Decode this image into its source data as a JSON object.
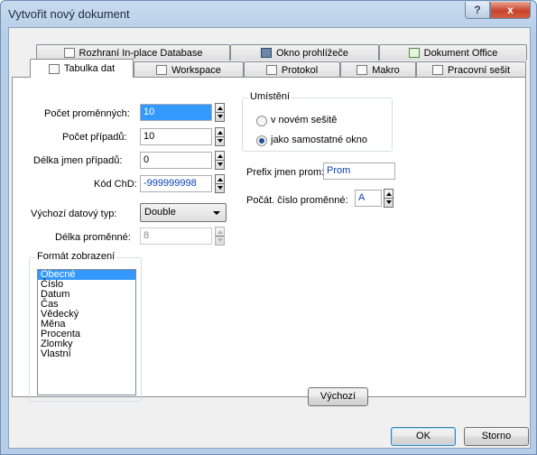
{
  "window": {
    "title": "Vytvořit nový dokument",
    "help_label": "?",
    "close_label": "x"
  },
  "tabs_back": [
    {
      "label": "Rozhraní In-place Database",
      "icon": "database-icon"
    },
    {
      "label": "Okno prohlížeče",
      "icon": "browser-icon"
    },
    {
      "label": "Dokument Office",
      "icon": "excel-icon"
    }
  ],
  "tabs_front": [
    {
      "label": "Tabulka dat",
      "icon": "table-icon",
      "active": true
    },
    {
      "label": "Workspace",
      "icon": "workspace-icon"
    },
    {
      "label": "Protokol",
      "icon": "document-icon"
    },
    {
      "label": "Makro",
      "icon": "macro-icon"
    },
    {
      "label": "Pracovní sešit",
      "icon": "workbook-icon"
    }
  ],
  "form": {
    "variables": {
      "label": "Počet proměnných:",
      "value": "10"
    },
    "cases": {
      "label": "Počet případů:",
      "value": "10"
    },
    "case_name_length": {
      "label": "Délka jmen případů:",
      "value": "0"
    },
    "md_code": {
      "label": "Kód ChD:",
      "value": "-999999998"
    },
    "default_type": {
      "label": "Výchozí datový typ:",
      "value": "Double"
    },
    "variable_length": {
      "label": "Délka proměnné:",
      "value": "8"
    }
  },
  "placement": {
    "title": "Umístění",
    "options": [
      {
        "label": "v novém sešitě",
        "selected": false
      },
      {
        "label": "jako samostatné okno",
        "selected": true
      }
    ]
  },
  "prefix": {
    "label": "Prefix jmen prom:",
    "value": "Prom"
  },
  "start_number": {
    "label": "Počát. číslo proměnné:",
    "value": "A"
  },
  "format": {
    "title": "Formát zobrazení",
    "items": [
      "Obecné",
      "Číslo",
      "Datum",
      "Čas",
      "Vědecký",
      "Měna",
      "Procenta",
      "Zlomky",
      "Vlastní"
    ],
    "selected": "Obecné"
  },
  "buttons": {
    "default_label": "Výchozí",
    "ok_label": "OK",
    "cancel_label": "Storno"
  }
}
